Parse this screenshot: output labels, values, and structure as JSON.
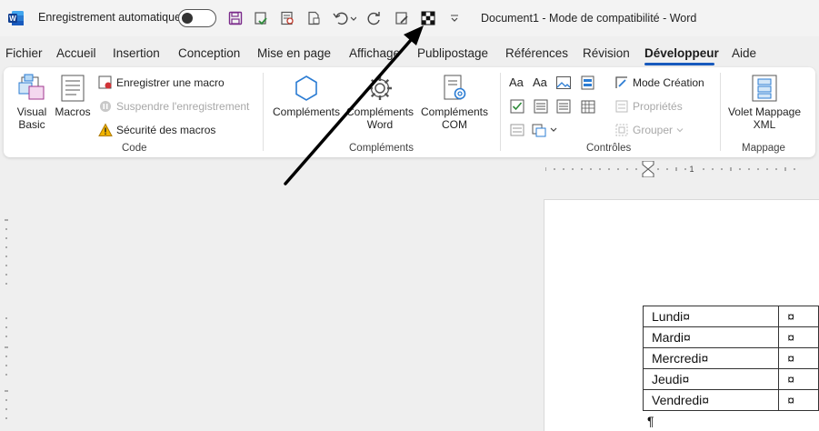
{
  "titlebar": {
    "autosave_label": "Enregistrement automatique",
    "document_title": "Document1  -  Mode de compatibilité  -  Word",
    "autosave_state": "off"
  },
  "tabs": [
    {
      "label": "Fichier"
    },
    {
      "label": "Accueil"
    },
    {
      "label": "Insertion"
    },
    {
      "label": "Conception"
    },
    {
      "label": "Mise en page"
    },
    {
      "label": "Affichage"
    },
    {
      "label": "Publipostage"
    },
    {
      "label": "Références"
    },
    {
      "label": "Révision"
    },
    {
      "label": "Développeur",
      "active": true
    },
    {
      "label": "Aide"
    }
  ],
  "ribbon": {
    "code": {
      "label": "Code",
      "visual_basic": "Visual Basic",
      "macros": "Macros",
      "record_macro": "Enregistrer une macro",
      "pause_recording": "Suspendre l'enregistrement",
      "macro_security": "Sécurité des macros"
    },
    "addins": {
      "label": "Compléments",
      "addins": "Compléments",
      "word_addins": "Compléments Word",
      "com_addins": "Compléments COM"
    },
    "controls": {
      "label": "Contrôles",
      "design_mode": "Mode Création",
      "properties": "Propriétés",
      "group": "Grouper"
    },
    "mapping": {
      "label": "Mappage",
      "xml_pane": "Volet Mappage XML"
    }
  },
  "ruler": {
    "tick_label": "1"
  },
  "document": {
    "rows": [
      {
        "day": "Lundi¤",
        "mark": "¤"
      },
      {
        "day": "Mardi¤",
        "mark": "¤"
      },
      {
        "day": "Mercredi¤",
        "mark": "¤"
      },
      {
        "day": "Jeudi¤",
        "mark": "¤"
      },
      {
        "day": "Vendredi¤",
        "mark": "¤"
      }
    ],
    "paragraph_mark": "¶"
  },
  "colors": {
    "accent": "#185abd",
    "word_blue": "#2b579a",
    "annotation_arrow": "#000000"
  }
}
